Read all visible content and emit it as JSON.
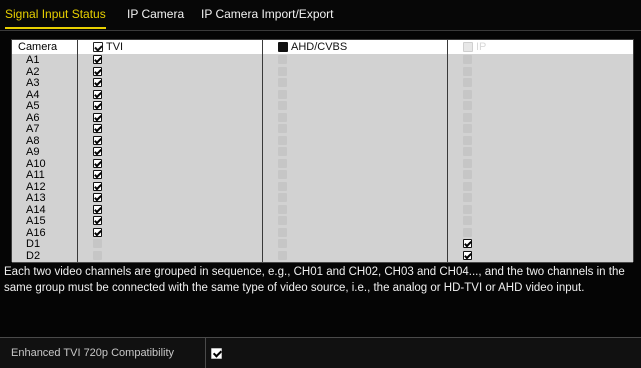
{
  "tabs": [
    {
      "label": "Signal Input Status",
      "active": true
    },
    {
      "label": "IP Camera",
      "active": false
    },
    {
      "label": "IP Camera Import/Export",
      "active": false
    }
  ],
  "table": {
    "headers": {
      "camera": "Camera",
      "tvi": {
        "label": "TVI",
        "state": "checked"
      },
      "ahd": {
        "label": "AHD/CVBS",
        "state": "filled"
      },
      "ip": {
        "label": "IP",
        "state": "disabled"
      }
    },
    "rows": [
      {
        "camera": "A1",
        "tvi": true,
        "ahd": false,
        "ip": false
      },
      {
        "camera": "A2",
        "tvi": true,
        "ahd": false,
        "ip": false
      },
      {
        "camera": "A3",
        "tvi": true,
        "ahd": false,
        "ip": false
      },
      {
        "camera": "A4",
        "tvi": true,
        "ahd": false,
        "ip": false
      },
      {
        "camera": "A5",
        "tvi": true,
        "ahd": false,
        "ip": false
      },
      {
        "camera": "A6",
        "tvi": true,
        "ahd": false,
        "ip": false
      },
      {
        "camera": "A7",
        "tvi": true,
        "ahd": false,
        "ip": false
      },
      {
        "camera": "A8",
        "tvi": true,
        "ahd": false,
        "ip": false
      },
      {
        "camera": "A9",
        "tvi": true,
        "ahd": false,
        "ip": false
      },
      {
        "camera": "A10",
        "tvi": true,
        "ahd": false,
        "ip": false
      },
      {
        "camera": "A11",
        "tvi": true,
        "ahd": false,
        "ip": false
      },
      {
        "camera": "A12",
        "tvi": true,
        "ahd": false,
        "ip": false
      },
      {
        "camera": "A13",
        "tvi": true,
        "ahd": false,
        "ip": false
      },
      {
        "camera": "A14",
        "tvi": true,
        "ahd": false,
        "ip": false
      },
      {
        "camera": "A15",
        "tvi": true,
        "ahd": false,
        "ip": false
      },
      {
        "camera": "A16",
        "tvi": true,
        "ahd": false,
        "ip": false
      },
      {
        "camera": "D1",
        "tvi": false,
        "ahd": false,
        "ip": true
      },
      {
        "camera": "D2",
        "tvi": false,
        "ahd": false,
        "ip": true
      }
    ]
  },
  "note": "Each two video channels are grouped in sequence, e.g., CH01 and CH02, CH03 and CH04..., and the two channels in the same group must be connected with the same type of video source, i.e., the analog or HD-TVI or AHD video input.",
  "footer": {
    "label": "Enhanced TVI 720p Compatibility",
    "checked": true
  },
  "colors": {
    "active_tab": "#e8d000",
    "background": "#050505",
    "row_bg": "#d2d2d2"
  }
}
